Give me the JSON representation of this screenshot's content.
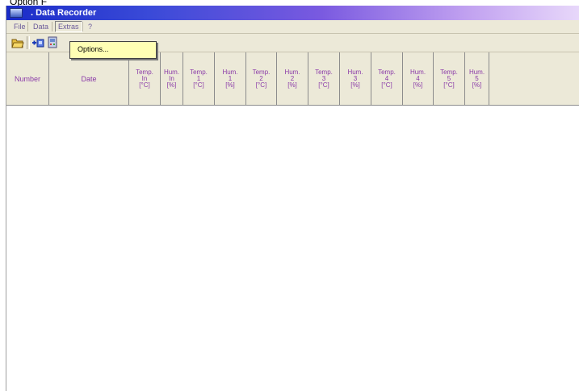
{
  "caption": "Option F",
  "window": {
    "title": ". Data Recorder"
  },
  "menu": {
    "items": [
      "File",
      "Data",
      "Extras",
      "?"
    ]
  },
  "dropdown": {
    "items": [
      "Options..."
    ]
  },
  "toolbar": {
    "buttons": [
      "open-folder-icon",
      "add-entry-icon",
      "device-icon"
    ]
  },
  "grid": {
    "columns": [
      {
        "lines": [
          "Number"
        ]
      },
      {
        "lines": [
          "Date"
        ]
      },
      {
        "lines": [
          "Temp.",
          "In",
          "[°C]"
        ]
      },
      {
        "lines": [
          "Hum.",
          "In",
          "[%]"
        ]
      },
      {
        "lines": [
          "Temp.",
          "1",
          "[°C]"
        ]
      },
      {
        "lines": [
          "Hum.",
          "1",
          "[%]"
        ]
      },
      {
        "lines": [
          "Temp.",
          "2",
          "[°C]"
        ]
      },
      {
        "lines": [
          "Hum.",
          "2",
          "[%]"
        ]
      },
      {
        "lines": [
          "Temp.",
          "3",
          "[°C]"
        ]
      },
      {
        "lines": [
          "Hum.",
          "3",
          "[%]"
        ]
      },
      {
        "lines": [
          "Temp.",
          "4",
          "[°C]"
        ]
      },
      {
        "lines": [
          "Hum.",
          "4",
          "[%]"
        ]
      },
      {
        "lines": [
          "Temp.",
          "5",
          "[°C]"
        ]
      },
      {
        "lines": [
          "Hum.",
          "5",
          "[%]"
        ]
      }
    ]
  },
  "colors": {
    "header_text": "#8a3aa8",
    "menu_text": "#6a5a9a",
    "dropdown_bg": "#ffffb4"
  }
}
